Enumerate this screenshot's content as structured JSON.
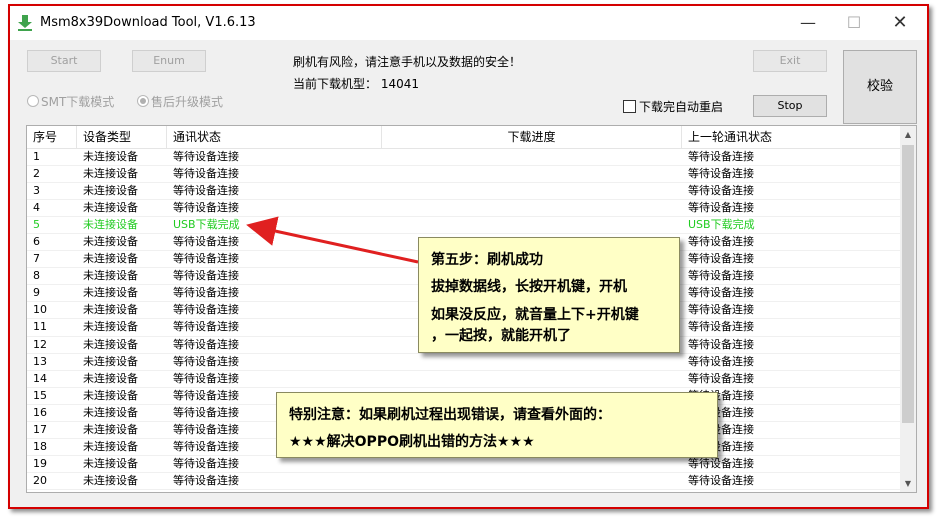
{
  "window": {
    "title": "Msm8x39Download Tool, V1.6.13",
    "minimize_glyph": "—",
    "maximize_glyph": "☐",
    "close_glyph": "✕"
  },
  "toolbar": {
    "start_label": "Start",
    "enum_label": "Enum",
    "exit_label": "Exit",
    "stop_label": "Stop",
    "verify_label": "校验"
  },
  "modes": {
    "smt_label": "SMT下载模式",
    "aftersale_label": "售后升级模式",
    "selected": "售后升级模式"
  },
  "info": {
    "warning_text": "刷机有风险，请注意手机以及数据的安全！",
    "model_text": "当前下载机型：  14041",
    "auto_restart_label": "下载完自动重启",
    "auto_restart_checked": false
  },
  "table": {
    "columns": [
      "序号",
      "设备类型",
      "通讯状态",
      "下载进度",
      "上一轮通讯状态"
    ],
    "rows": [
      {
        "no": "1",
        "type": "未连接设备",
        "status": "等待设备连接",
        "progress": "",
        "last": "等待设备连接",
        "ok": false
      },
      {
        "no": "2",
        "type": "未连接设备",
        "status": "等待设备连接",
        "progress": "",
        "last": "等待设备连接",
        "ok": false
      },
      {
        "no": "3",
        "type": "未连接设备",
        "status": "等待设备连接",
        "progress": "",
        "last": "等待设备连接",
        "ok": false
      },
      {
        "no": "4",
        "type": "未连接设备",
        "status": "等待设备连接",
        "progress": "",
        "last": "等待设备连接",
        "ok": false
      },
      {
        "no": "5",
        "type": "未连接设备",
        "status": "USB下载完成",
        "progress": "",
        "last": "USB下载完成",
        "ok": true
      },
      {
        "no": "6",
        "type": "未连接设备",
        "status": "等待设备连接",
        "progress": "",
        "last": "等待设备连接",
        "ok": false
      },
      {
        "no": "7",
        "type": "未连接设备",
        "status": "等待设备连接",
        "progress": "",
        "last": "等待设备连接",
        "ok": false
      },
      {
        "no": "8",
        "type": "未连接设备",
        "status": "等待设备连接",
        "progress": "",
        "last": "等待设备连接",
        "ok": false
      },
      {
        "no": "9",
        "type": "未连接设备",
        "status": "等待设备连接",
        "progress": "",
        "last": "等待设备连接",
        "ok": false
      },
      {
        "no": "10",
        "type": "未连接设备",
        "status": "等待设备连接",
        "progress": "",
        "last": "等待设备连接",
        "ok": false
      },
      {
        "no": "11",
        "type": "未连接设备",
        "status": "等待设备连接",
        "progress": "",
        "last": "等待设备连接",
        "ok": false
      },
      {
        "no": "12",
        "type": "未连接设备",
        "status": "等待设备连接",
        "progress": "",
        "last": "等待设备连接",
        "ok": false
      },
      {
        "no": "13",
        "type": "未连接设备",
        "status": "等待设备连接",
        "progress": "",
        "last": "等待设备连接",
        "ok": false
      },
      {
        "no": "14",
        "type": "未连接设备",
        "status": "等待设备连接",
        "progress": "",
        "last": "等待设备连接",
        "ok": false
      },
      {
        "no": "15",
        "type": "未连接设备",
        "status": "等待设备连接",
        "progress": "",
        "last": "等待设备连接",
        "ok": false
      },
      {
        "no": "16",
        "type": "未连接设备",
        "status": "等待设备连接",
        "progress": "",
        "last": "等待设备连接",
        "ok": false
      },
      {
        "no": "17",
        "type": "未连接设备",
        "status": "等待设备连接",
        "progress": "",
        "last": "等待设备连接",
        "ok": false
      },
      {
        "no": "18",
        "type": "未连接设备",
        "status": "等待设备连接",
        "progress": "",
        "last": "等待设备连接",
        "ok": false
      },
      {
        "no": "19",
        "type": "未连接设备",
        "status": "等待设备连接",
        "progress": "",
        "last": "等待设备连接",
        "ok": false
      },
      {
        "no": "20",
        "type": "未连接设备",
        "status": "等待设备连接",
        "progress": "",
        "last": "等待设备连接",
        "ok": false
      }
    ]
  },
  "annotations": {
    "note1": {
      "line1": "第五步：刷机成功",
      "line2": "拔掉数据线，长按开机键，开机",
      "line3": "如果没反应，就音量上下+开机键",
      "line4": "，一起按，就能开机了"
    },
    "note2": {
      "line1": "特别注意：如果刷机过程出现错误，请查看外面的：",
      "line2": "★★★解决OPPO刷机出错的方法★★★"
    },
    "arrow_color": "#e02020"
  },
  "colors": {
    "frame_border": "#d40000",
    "success_text": "#22cc22",
    "note_background": "#ffffc6",
    "app_icon": "#3fa34d"
  },
  "icons": {
    "app": "download-arrow-icon",
    "scroll_up": "chevron-up-icon",
    "scroll_down": "chevron-down-icon"
  }
}
